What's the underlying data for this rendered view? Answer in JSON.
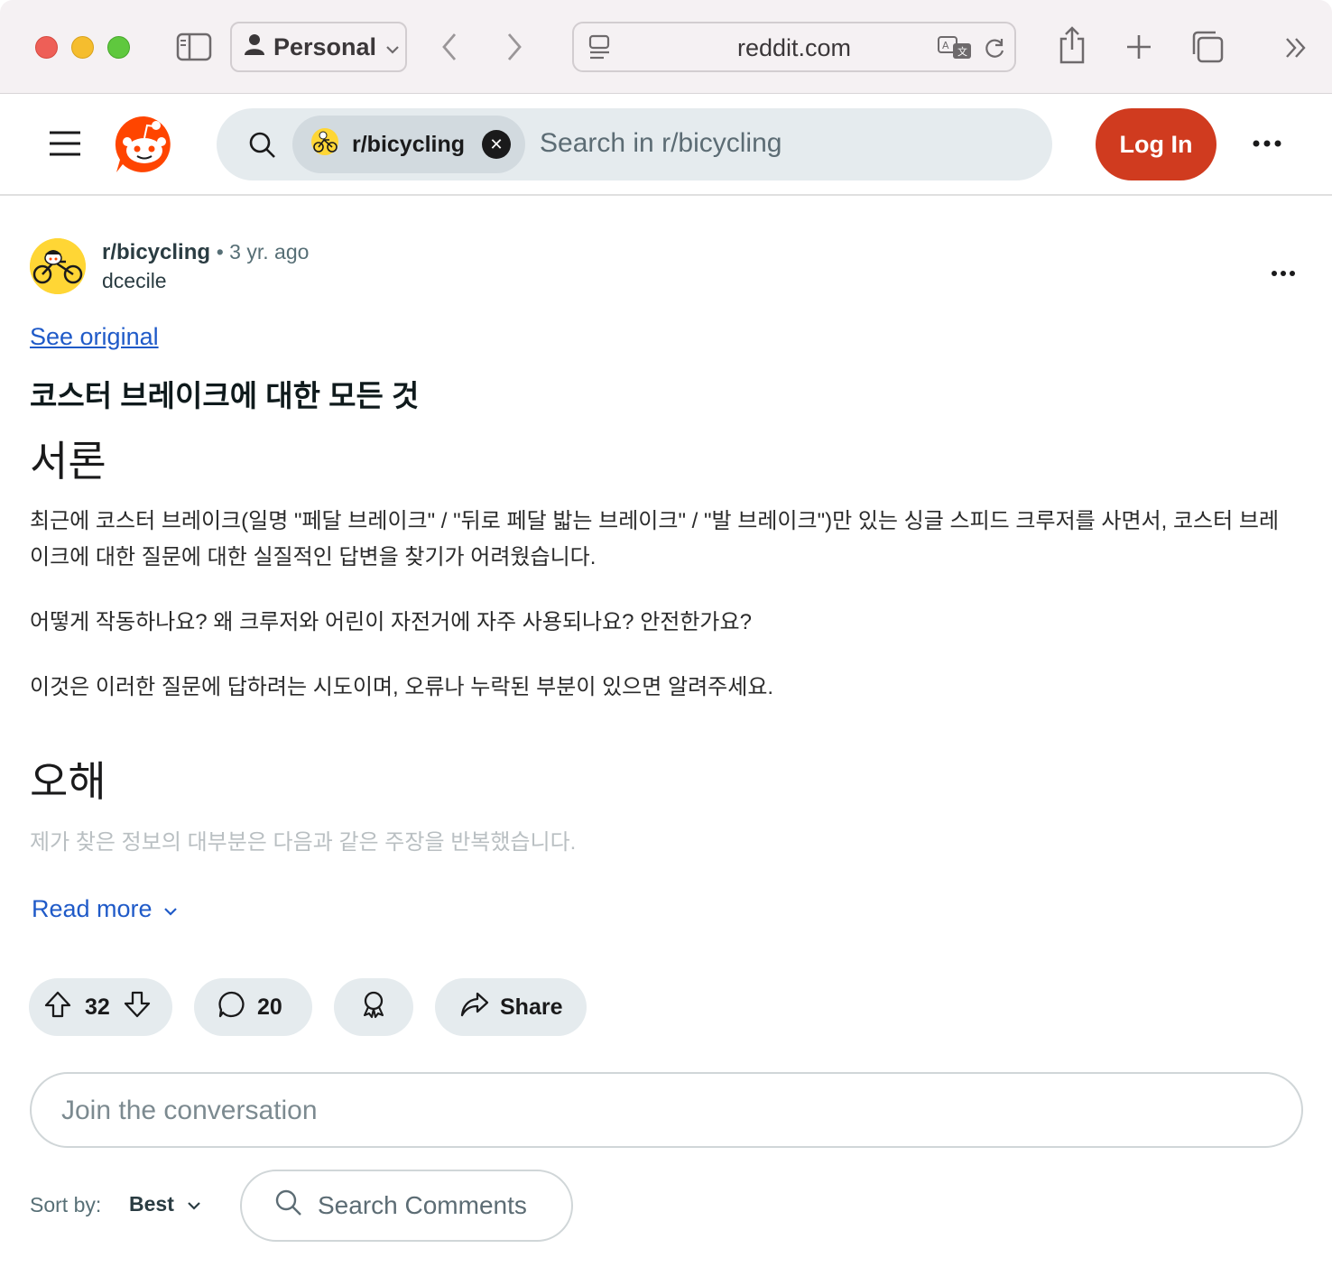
{
  "browser": {
    "profile_label": "Personal",
    "address": "reddit.com"
  },
  "header": {
    "subreddit_chip": "r/bicycling",
    "search_placeholder": "Search in r/bicycling",
    "login_label": "Log In"
  },
  "post": {
    "subreddit": "r/bicycling",
    "time": "3 yr. ago",
    "author": "dcecile",
    "see_original": "See original",
    "title": "코스터 브레이크에 대한 모든 것",
    "heading_intro": "서론",
    "para1": "최근에 코스터 브레이크(일명 \"페달 브레이크\" / \"뒤로 페달 밟는 브레이크\" / \"발 브레이크\")만 있는 싱글 스피드 크루저를 사면서, 코스터 브레이크에 대한 질문에 대한 실질적인 답변을 찾기가 어려웠습니다.",
    "para2": "어떻게 작동하나요? 왜 크루저와 어린이 자전거에 자주 사용되나요? 안전한가요?",
    "para3": "이것은 이러한 질문에 답하려는 시도이며, 오류나 누락된 부분이 있으면 알려주세요.",
    "heading_misconceptions": "오해",
    "para4": "제가 찾은 정보의 대부분은 다음과 같은 주장을 반복했습니다.",
    "read_more": "Read more"
  },
  "actions": {
    "votes": "32",
    "comments": "20",
    "share_label": "Share"
  },
  "comments": {
    "join_placeholder": "Join the conversation",
    "sort_label": "Sort by:",
    "sort_value": "Best",
    "search_placeholder": "Search Comments"
  }
}
